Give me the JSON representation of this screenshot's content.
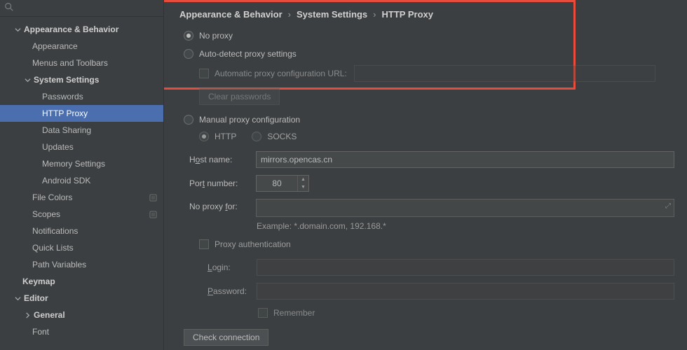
{
  "search": {
    "placeholder": ""
  },
  "sidebar": [
    {
      "label": "Appearance & Behavior",
      "indent": 18,
      "chevron": "down",
      "bold": true
    },
    {
      "label": "Appearance",
      "indent": 46
    },
    {
      "label": "Menus and Toolbars",
      "indent": 46
    },
    {
      "label": "System Settings",
      "indent": 32,
      "chevron": "down",
      "bold": true
    },
    {
      "label": "Passwords",
      "indent": 60
    },
    {
      "label": "HTTP Proxy",
      "indent": 60,
      "selected": true
    },
    {
      "label": "Data Sharing",
      "indent": 60
    },
    {
      "label": "Updates",
      "indent": 60
    },
    {
      "label": "Memory Settings",
      "indent": 60
    },
    {
      "label": "Android SDK",
      "indent": 60
    },
    {
      "label": "File Colors",
      "indent": 46,
      "badge": true
    },
    {
      "label": "Scopes",
      "indent": 46,
      "badge": true
    },
    {
      "label": "Notifications",
      "indent": 46
    },
    {
      "label": "Quick Lists",
      "indent": 46
    },
    {
      "label": "Path Variables",
      "indent": 46
    },
    {
      "label": "Keymap",
      "indent": 32,
      "bold": true
    },
    {
      "label": "Editor",
      "indent": 18,
      "chevron": "down",
      "bold": true
    },
    {
      "label": "General",
      "indent": 32,
      "chevron": "right",
      "bold": true
    },
    {
      "label": "Font",
      "indent": 46
    }
  ],
  "breadcrumb": [
    "Appearance & Behavior",
    "System Settings",
    "HTTP Proxy"
  ],
  "proxy": {
    "no_proxy_label": "No proxy",
    "auto_detect_label": "Auto-detect proxy settings",
    "auto_config_label": "Automatic proxy configuration URL:",
    "clear_passwords_btn": "Clear passwords",
    "manual_label": "Manual proxy configuration",
    "http_label": "HTTP",
    "socks_label": "SOCKS",
    "host_label_pre": "H",
    "host_label_u": "o",
    "host_label_post": "st name:",
    "host_value": "mirrors.opencas.cn",
    "port_label_pre": "Por",
    "port_label_u": "t",
    "port_label_post": " number:",
    "port_value": "80",
    "noproxyfor_label_pre": "No proxy ",
    "noproxyfor_label_u": "f",
    "noproxyfor_label_post": "or:",
    "example_hint": "Example: *.domain.com, 192.168.*",
    "proxy_auth_label": "Proxy authentication",
    "login_label_u": "L",
    "login_label_post": "ogin:",
    "password_label_pre": "",
    "password_label_u": "P",
    "password_label_post": "assword:",
    "remember_label": "Remember",
    "check_connection_btn": "Check connection"
  }
}
